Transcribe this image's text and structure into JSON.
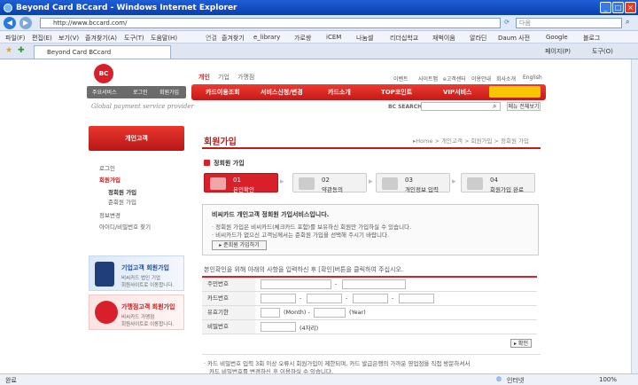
{
  "window": {
    "title": "Beyond Card BCcard - Windows Internet Explorer"
  },
  "addressbar": {
    "url": "http://www.bccard.com/",
    "search_placeholder": "다음"
  },
  "menu": [
    "파일(F)",
    "편집(E)",
    "보기(V)",
    "즐겨찾기(A)",
    "도구(T)",
    "도움말(H)"
  ],
  "links_label": "연결",
  "links": [
    "즐겨찾기",
    "e_library",
    "가로쌍",
    "iCEM",
    "나눔셀",
    "리더십학교",
    "재벅이움",
    "알라딘",
    "Daum 사전",
    "Google",
    "블로그"
  ],
  "tab": {
    "label": "Beyond Card BCcard"
  },
  "tab_tools": [
    "페이지(P)",
    "도구(O)"
  ],
  "site": {
    "logo": "BC",
    "topnav": [
      "개인",
      "기업",
      "가맹점"
    ],
    "utility": [
      "이벤트",
      "사이트맵",
      "e고객센터",
      "이용안내",
      "회사소개",
      "English"
    ],
    "quick": [
      "주요서비스",
      "로그인",
      "회원가입"
    ],
    "mainnav": [
      "카드이용조회",
      "서비스신청/변경",
      "카드소개",
      "TOP포인트",
      "VIP서비스"
    ],
    "slogan": "Global payment service provider",
    "search_label": "BC SEARCH",
    "menu_all": "메뉴 전체보기"
  },
  "sidebar": {
    "head": "개인고객",
    "items": [
      "로그인",
      "회원가입",
      "정회원 가입",
      "준회원 가입",
      "정보변경",
      "아이디/비밀번호 찾기"
    ],
    "ad1": {
      "title": "기업고객 회원가입",
      "sub1": "비씨카드 법인 기업",
      "sub2": "회원사이트로 이동합니다."
    },
    "ad2": {
      "title": "가맹점고객 회원가입",
      "sub1": "비씨카드 가맹점",
      "sub2": "회원사이트로 이동합니다."
    }
  },
  "content": {
    "title": "회원가입",
    "breadcrumb": "▸Home > 개인고객 > 회원가입 > 정회원 가입",
    "section": "정회원 가입",
    "steps": [
      {
        "num": "01",
        "label": "본인확인"
      },
      {
        "num": "02",
        "label": "약관동의"
      },
      {
        "num": "03",
        "label": "개인정보 입력"
      },
      {
        "num": "04",
        "label": "회원가입 완료"
      }
    ],
    "notice": {
      "title": "비씨카드 개인고객 정회원 가입서비스입니다.",
      "line1": "· 정회원 가입은 비씨카드(체크카드 포함)를 보유하신 회원만 가입하실 수 있습니다.",
      "line2": "· 비씨카드가 없으신 고객님께서는 준회원 가입을 선택해 주시기 바랍니다.",
      "button": "▸ 준회원 가입하기"
    },
    "instruction": "본인확인을 위해 아래의 사항을 입력하신 후 [확인]버튼을 클릭하여 주십시오.",
    "form": {
      "rows": [
        "주민번호",
        "카드번호",
        "유효기한",
        "비밀번호"
      ],
      "month": "(Month) -",
      "year": "(Year)",
      "pw_hint": "(4자리)"
    },
    "confirm": "▸ 확인",
    "footnote1": "· 카드 비밀번호 입력 3회 이상 오류시 회원가입이 제한되며, 카드 발급은행의 가까운 영업점을 직접 방문하셔서",
    "footnote2": "카드 비밀번호를 변경하신 후 이용하실 수 있습니다."
  },
  "status": {
    "left": "완료",
    "zone": "인터넷",
    "zoom": "100%"
  }
}
